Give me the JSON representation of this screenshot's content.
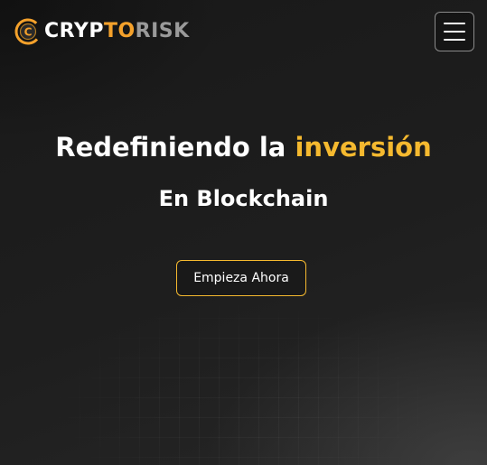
{
  "header": {
    "logo": {
      "text_part1": "CRYPTO",
      "text_part1_lead": "",
      "text_c": "",
      "text_part2": "RISK",
      "icon": "crypto-coin-logo-icon"
    },
    "menu_icon": "hamburger-menu-icon"
  },
  "hero": {
    "title_main": "Redefiniendo la",
    "title_accent": "inversión",
    "subtitle": "En Blockchain",
    "cta_label": "Empieza Ahora"
  },
  "colors": {
    "accent": "#f5b92f",
    "logo_orange": "#f4a12b",
    "logo_gray": "#9a9a9a",
    "background": "#1f1f1f"
  }
}
